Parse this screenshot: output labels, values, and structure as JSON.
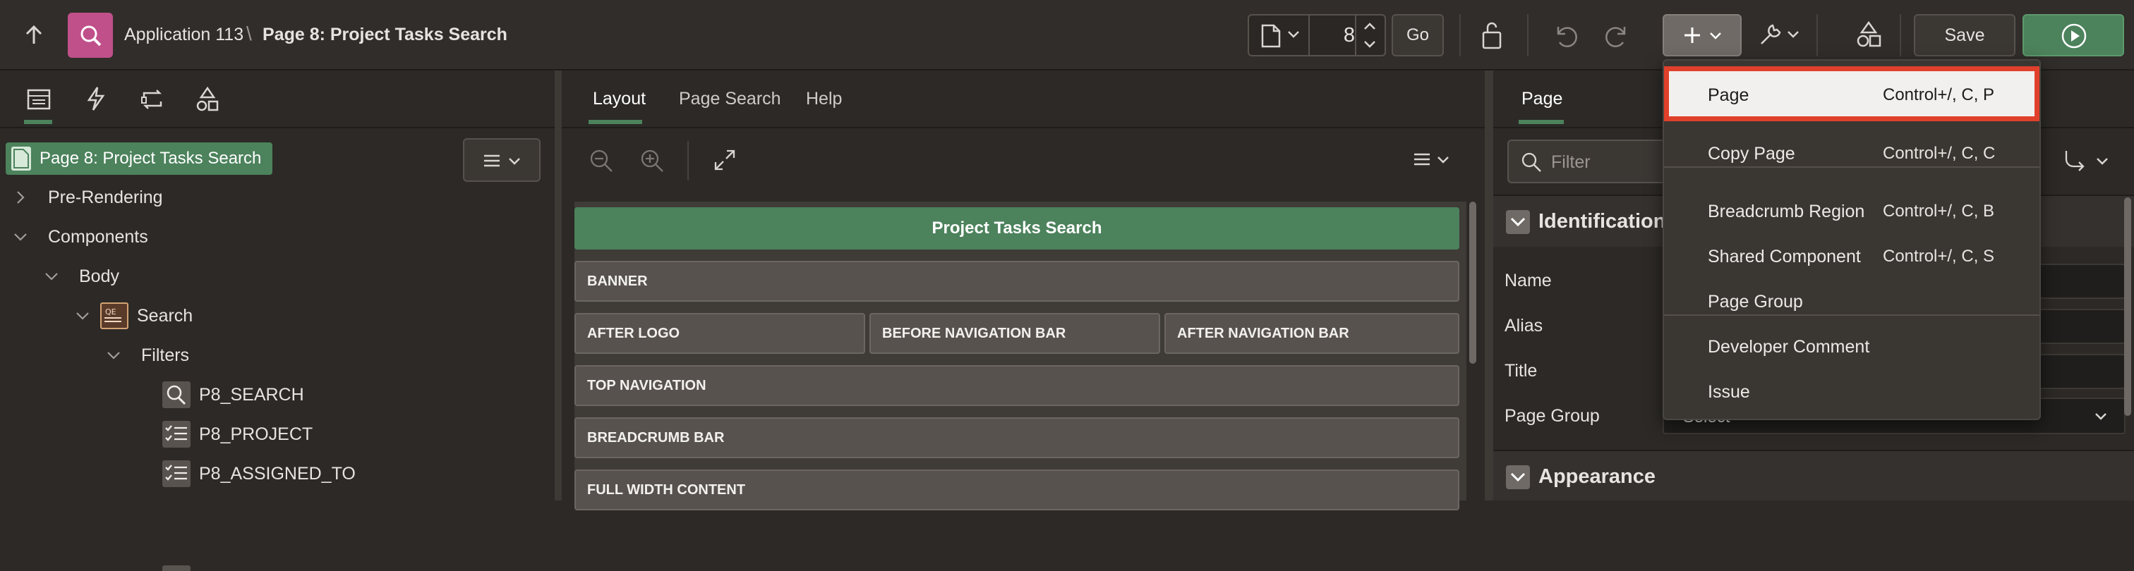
{
  "header": {
    "app_name": "Application 113",
    "separator": "\\",
    "page_title": "Page 8: Project Tasks Search",
    "page_number": "8",
    "go_label": "Go",
    "save_label": "Save"
  },
  "left": {
    "root_label": "Page 8: Project Tasks Search",
    "tree": [
      {
        "label": "Pre-Rendering"
      },
      {
        "label": "Components"
      },
      {
        "label": "Body"
      },
      {
        "label": "Search"
      },
      {
        "label": "Filters"
      },
      {
        "label": "P8_SEARCH"
      },
      {
        "label": "P8_PROJECT"
      },
      {
        "label": "P8_ASSIGNED_TO"
      }
    ]
  },
  "middle": {
    "tabs": [
      "Layout",
      "Page Search",
      "Help"
    ],
    "page_header": "Project Tasks Search",
    "regions": {
      "banner": "BANNER",
      "after_logo": "AFTER LOGO",
      "before_nav": "BEFORE NAVIGATION BAR",
      "after_nav": "AFTER NAVIGATION BAR",
      "top_nav": "TOP NAVIGATION",
      "breadcrumb": "BREADCRUMB BAR",
      "full_width": "FULL WIDTH CONTENT"
    }
  },
  "right": {
    "tab": "Page",
    "filter_placeholder": "Filter",
    "section_identification": "Identification",
    "labels": [
      "Name",
      "Alias",
      "Title",
      "Page Group"
    ],
    "page_group_value": "- Select -",
    "section_appearance": "Appearance"
  },
  "create_menu": {
    "items": [
      {
        "label": "Page",
        "shortcut": "Control+/, C, P"
      },
      {
        "label": "Copy Page",
        "shortcut": "Control+/, C, C"
      },
      {
        "label": "Breadcrumb Region",
        "shortcut": "Control+/, C, B"
      },
      {
        "label": "Shared Component",
        "shortcut": "Control+/, C, S"
      },
      {
        "label": "Page Group",
        "shortcut": ""
      },
      {
        "label": "Developer Comment",
        "shortcut": ""
      },
      {
        "label": "Issue",
        "shortcut": ""
      }
    ]
  },
  "colors": {
    "accent_green": "#4c825c",
    "highlight_red": "#e0402b",
    "app_icon": "#c0508a"
  }
}
